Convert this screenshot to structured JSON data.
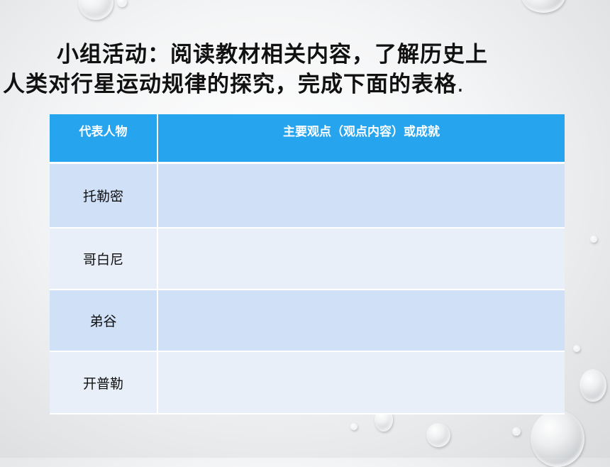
{
  "slide": {
    "title_line1": "小组活动：阅读教材相关内容，了解历史上",
    "title_line2": "人类对行星运动规律的探究，完成下面的表格",
    "title_period": "."
  },
  "table": {
    "headers": [
      "代表人物",
      "主要观点（观点内容）或成就"
    ],
    "rows": [
      {
        "person": "托勒密",
        "content": ""
      },
      {
        "person": "哥白尼",
        "content": ""
      },
      {
        "person": "弟谷",
        "content": ""
      },
      {
        "person": "开普勒",
        "content": ""
      }
    ]
  },
  "colors": {
    "header_bg": "#26a4ee",
    "row_odd_bg": "#cfe0f7",
    "row_even_bg": "#e8eff9"
  }
}
